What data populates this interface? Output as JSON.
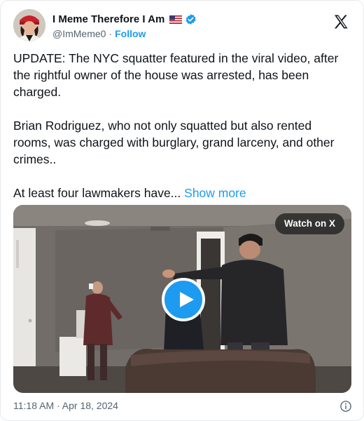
{
  "author": {
    "display_name": "I Meme Therefore I Am",
    "handle": "@ImMeme0",
    "separator": "·",
    "follow_label": "Follow",
    "avatar_icon": "portrait-avatar-icon",
    "flag_icon": "us-flag-icon",
    "verified_icon": "verified-badge-icon"
  },
  "platform": {
    "logo_icon": "x-logo-icon"
  },
  "tweet": {
    "paragraphs": [
      "UPDATE: The NYC squatter featured in the viral video, after the rightful owner of the house was arrested, has been charged.",
      "Brian Rodriguez, who not only squatted but also rented rooms, was charged with burglary, grand larceny, and other crimes.."
    ],
    "truncated_text": "At least four lawmakers have...",
    "show_more_label": "Show more"
  },
  "media": {
    "type": "video",
    "watch_label": "Watch on X",
    "play_icon": "play-icon"
  },
  "footer": {
    "timestamp": "11:18 AM · Apr 18, 2024",
    "info_icon": "info-icon"
  },
  "colors": {
    "link": "#1d9bf0",
    "text": "#0f1419",
    "muted": "#536471",
    "verified": "#1d9bf0"
  }
}
